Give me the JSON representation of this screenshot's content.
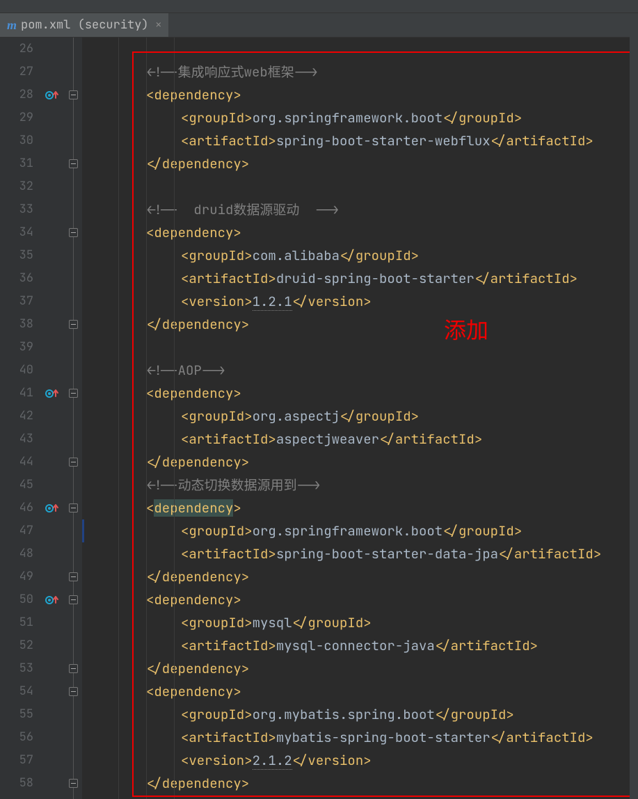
{
  "tab": {
    "label": "pom.xml (security)",
    "icon": "m"
  },
  "annotation": "添加",
  "lines": {
    "start": 26,
    "end": 58
  },
  "gutter_markers": [
    28,
    41,
    46,
    50
  ],
  "fold_open_rows": [
    28,
    31,
    34,
    38,
    41,
    44,
    46,
    49,
    50,
    53,
    54,
    58
  ],
  "caret_line": 47,
  "code": {
    "c27": "<!--集成响应式web框架-->",
    "c28o": "<dependency>",
    "c29g": "<groupId>",
    "c29t": "org.springframework.boot",
    "c30a": "<artifactId>",
    "c30t": "spring-boot-starter-webflux",
    "c31c": "</dependency>",
    "c33": "<!--  druid数据源驱动  -->",
    "c34o": "<dependency>",
    "c35g": "<groupId>",
    "c35t": "com.alibaba",
    "c36a": "<artifactId>",
    "c36t": "druid-spring-boot-starter",
    "c37v": "<version>",
    "c37t": "1.2.1",
    "c38c": "</dependency>",
    "c40": "<!--AOP-->",
    "c41o": "<dependency>",
    "c42g": "<groupId>",
    "c42t": "org.aspectj",
    "c43a": "<artifactId>",
    "c43t": "aspectjweaver",
    "c44c": "</dependency>",
    "c45": "<!--动态切换数据源用到-->",
    "c46o": "<",
    "c46name": "dependency",
    "c46c": ">",
    "c47g": "<groupId>",
    "c47t": "org.springframework.boot",
    "c48a": "<artifactId>",
    "c48t": "spring-boot-starter-data-jpa",
    "c49c": "</dependency>",
    "c50o": "<dependency>",
    "c51g": "<groupId>",
    "c51t": "mysql",
    "c52a": "<artifactId>",
    "c52t": "mysql-connector-java",
    "c53c": "</dependency>",
    "c54o": "<dependency>",
    "c55g": "<groupId>",
    "c55t": "org.mybatis.spring.boot",
    "c56a": "<artifactId>",
    "c56t": "mybatis-spring-boot-starter",
    "c57v": "<version>",
    "c57t": "2.1.2",
    "c58c": "</dependency>",
    "groupClose": "</groupId>",
    "artifactClose": "</artifactId>",
    "versionClose": "</version>"
  }
}
